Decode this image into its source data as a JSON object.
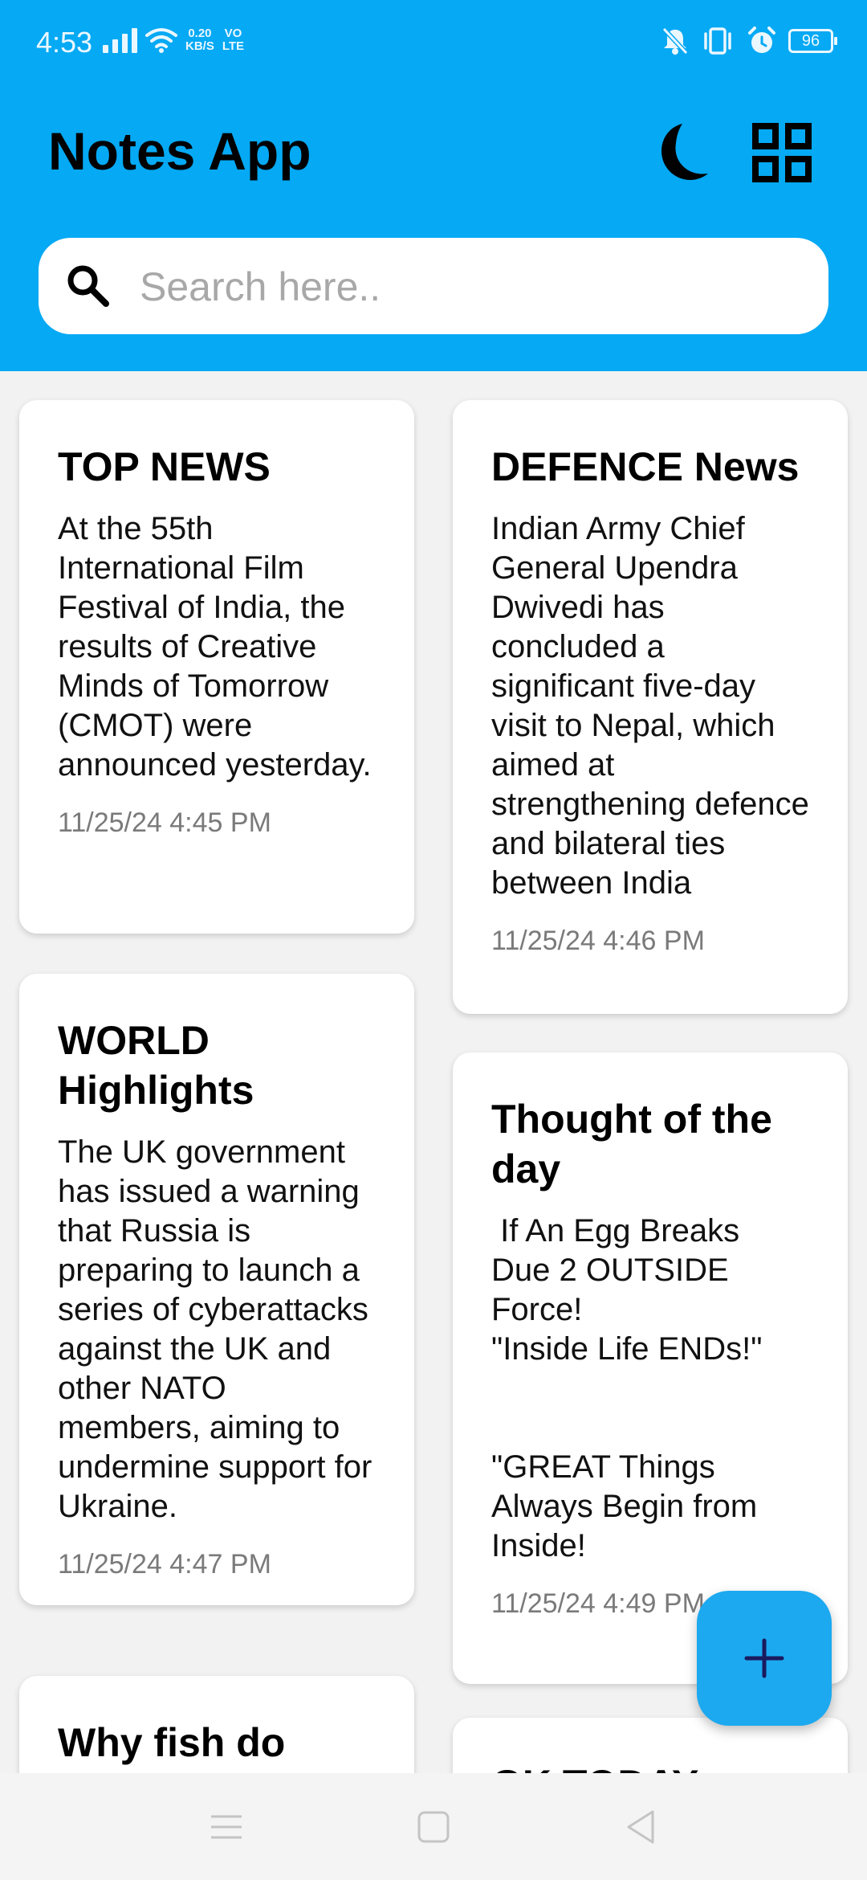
{
  "status_bar": {
    "time": "4:53",
    "net_speed_value": "0.20",
    "net_speed_unit": "KB/S",
    "network_label_1": "VO",
    "network_label_2": "LTE",
    "battery": "96"
  },
  "header": {
    "title": "Notes App",
    "theme_icon": "moon-icon",
    "layout_icon": "grid-view-icon"
  },
  "search": {
    "placeholder": "Search here.."
  },
  "notes": [
    {
      "title": "TOP NEWS",
      "body": "At the 55th International Film Festival of India, the results of Creative Minds of Tomorrow (CMOT) were announced yesterday.",
      "date": "11/25/24 4:45 PM"
    },
    {
      "title": "DEFENCE News",
      "body": "Indian Army Chief General Upendra Dwivedi has concluded a significant five-day visit to Nepal, which aimed at strengthening defence and bilateral ties between India",
      "date": "11/25/24 4:46 PM"
    },
    {
      "title": "WORLD Highlights",
      "body": "The UK government has issued a warning that Russia is preparing to launch a series of cyberattacks against the UK and other NATO members, aiming to undermine support for Ukraine.",
      "date": "11/25/24 4:47 PM"
    },
    {
      "title": "Thought of the day",
      "body": " If An Egg Breaks\nDue 2 OUTSIDE\nForce!\n\"Inside Life ENDs!\"\n\n\n\"GREAT Things\nAlways Begin from\nInside!",
      "date": "11/25/24 4:49 PM"
    },
    {
      "title": "Why fish do",
      "body": "",
      "date": ""
    },
    {
      "title": "GK TODAY",
      "body": "",
      "date": ""
    }
  ],
  "fab": {
    "icon": "plus-icon",
    "color": "#1ca9f0"
  },
  "colors": {
    "header_bg": "#05a9f4",
    "card_bg": "#ffffff",
    "page_bg": "#f2f2f2"
  }
}
